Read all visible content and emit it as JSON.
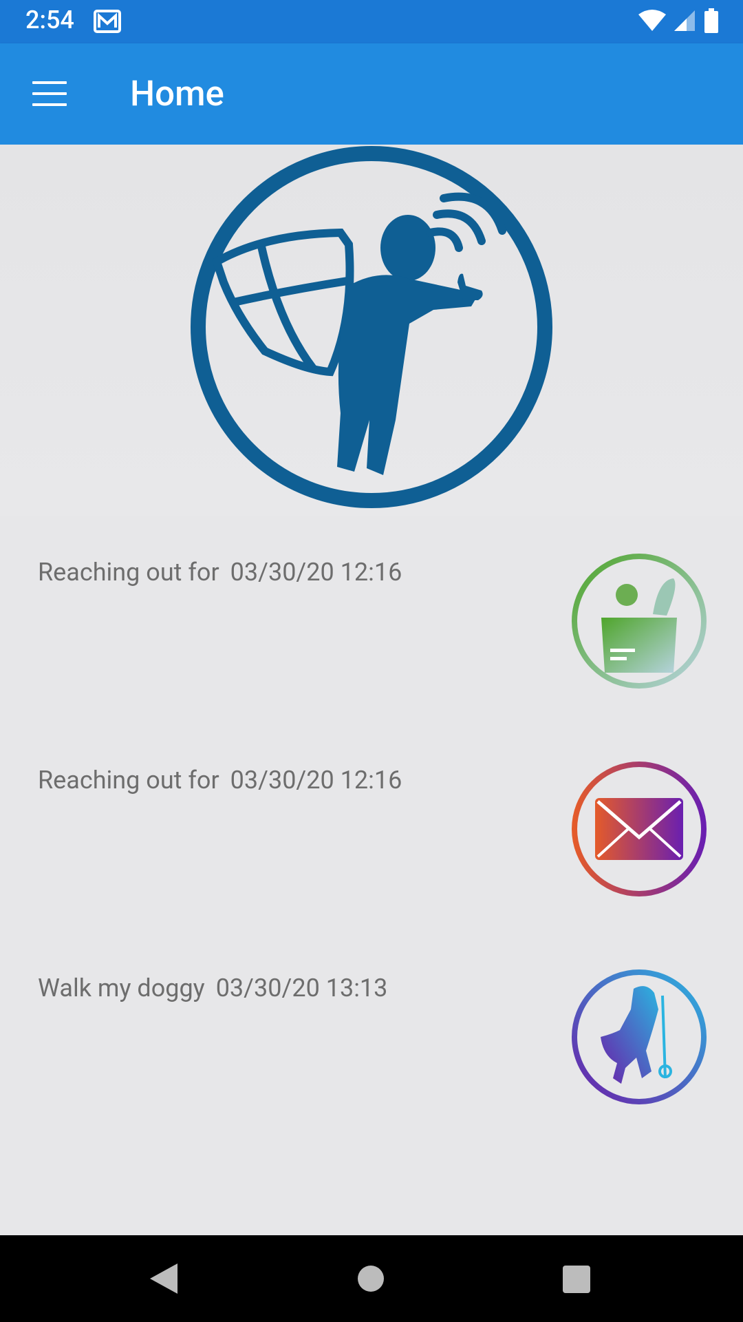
{
  "status_bar": {
    "time": "2:54",
    "icons": [
      "mail-icon",
      "wifi-icon",
      "cell-signal-icon",
      "battery-icon"
    ]
  },
  "app_bar": {
    "title": "Home",
    "menu_icon": "hamburger-menu-icon"
  },
  "hero": {
    "logo": "shield-person-waving-logo"
  },
  "items": [
    {
      "title": "Reaching out for",
      "datetime": "03/30/20 12:16",
      "icon": "grocery-bag-icon"
    },
    {
      "title": "Reaching out for",
      "datetime": "03/30/20 12:16",
      "icon": "envelope-icon"
    },
    {
      "title": "Walk my doggy",
      "datetime": "03/30/20 13:13",
      "icon": "dog-leash-icon"
    }
  ],
  "nav_bar": {
    "back": "back-icon",
    "home": "home-icon",
    "recents": "recents-icon"
  },
  "colors": {
    "status_bar": "#1b79d5",
    "app_bar": "#218be0",
    "logo_blue": "#0f5f94",
    "background": "#e7e7e9"
  }
}
